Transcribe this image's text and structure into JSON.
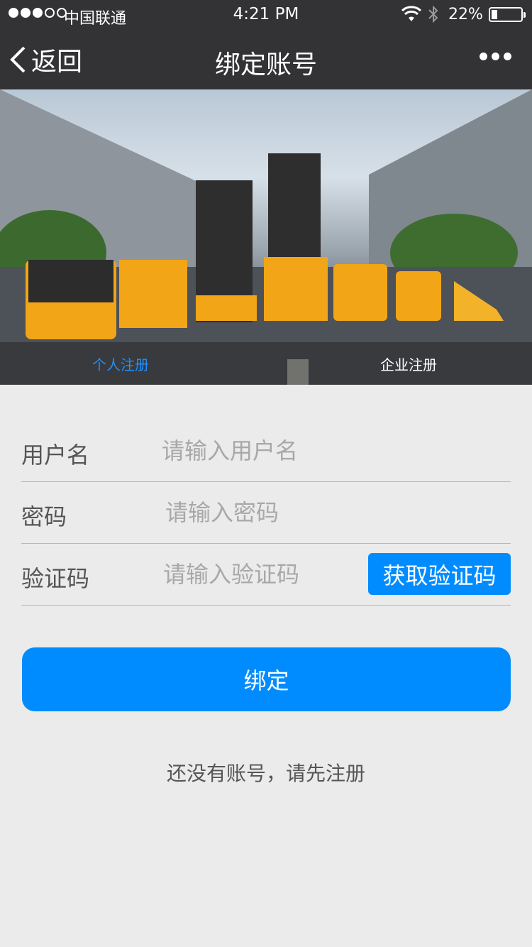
{
  "status_bar": {
    "signal_dots": [
      true,
      true,
      true,
      false,
      false
    ],
    "carrier": "中国联通",
    "time": "4:21 PM",
    "battery_percent": "22%",
    "battery_level": 0.22
  },
  "nav": {
    "back_label": "返回",
    "title": "绑定账号",
    "more_icon": "more-dots-icon"
  },
  "banner": {
    "tabs": [
      {
        "label": "个人注册",
        "active": true
      },
      {
        "label": "企业注册",
        "active": false
      }
    ]
  },
  "form": {
    "username": {
      "label": "用户名",
      "placeholder": "请输入用户名",
      "value": ""
    },
    "password": {
      "label": "密码",
      "placeholder": "请输入密码",
      "value": ""
    },
    "code": {
      "label": "验证码",
      "placeholder": "请输入验证码",
      "value": "",
      "button_label": "获取验证码"
    }
  },
  "bind_button_label": "绑定",
  "register_prompt": "还没有账号，请先注册",
  "colors": {
    "accent": "#008cff",
    "topbar": "#333335",
    "background": "#ebebeb",
    "active_tab": "#1e90ff"
  }
}
